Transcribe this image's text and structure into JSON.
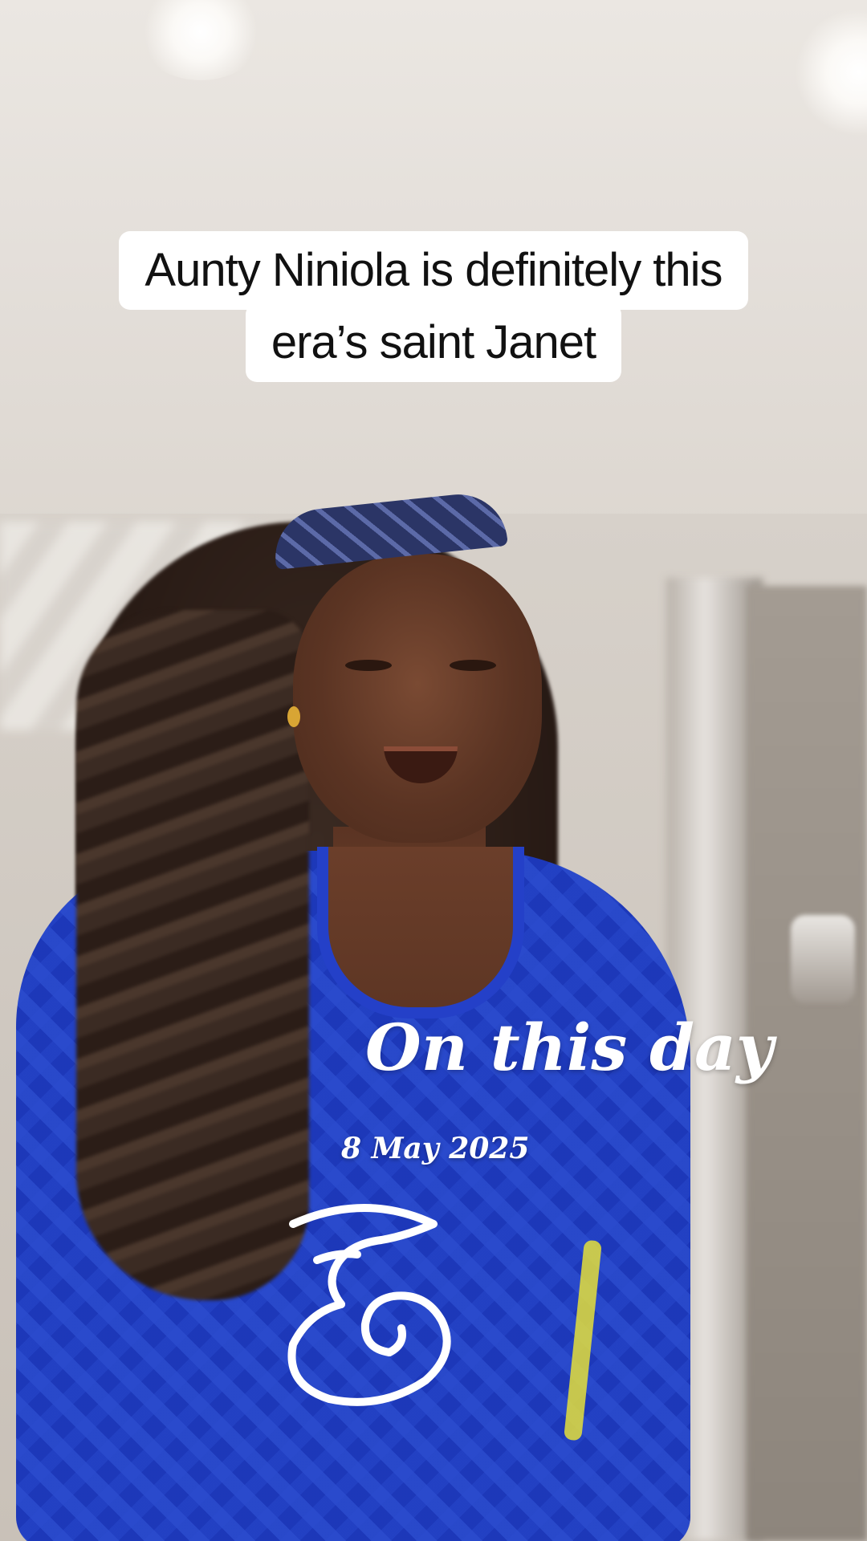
{
  "caption": {
    "line1": "Aunty Niniola is definitely this",
    "line2": "era’s saint Janet"
  },
  "overlay": {
    "title": "On this day",
    "date": "8 May 2025"
  },
  "colors": {
    "caption_bg": "#ffffff",
    "caption_text": "#111111",
    "overlay_text": "#ffffff",
    "jersey_blue": "#1e3dc2",
    "jersey_accent": "#e4df3a"
  },
  "icons": [
    "three-network-logo-icon"
  ]
}
